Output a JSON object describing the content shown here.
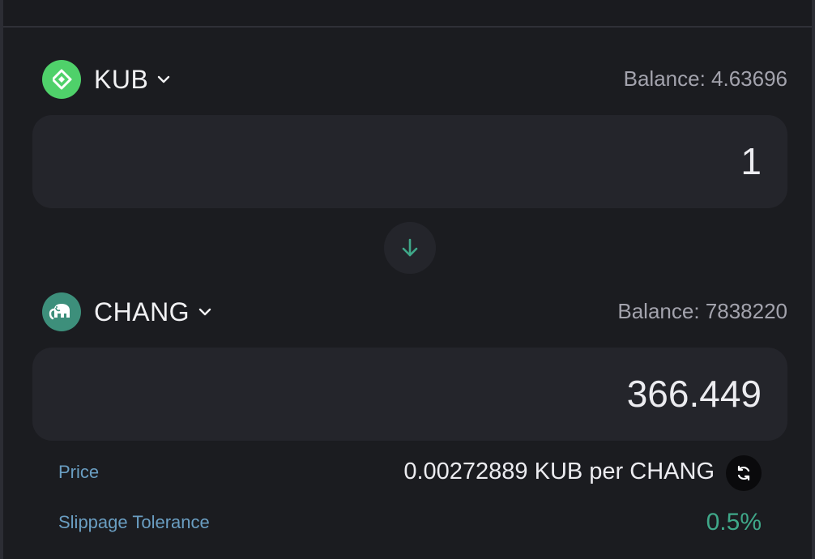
{
  "from": {
    "symbol": "KUB",
    "icon": "kub-logo-icon",
    "balance_text": "Balance: 4.63696",
    "amount": "1",
    "logo_color": "#4fd16a"
  },
  "to": {
    "symbol": "CHANG",
    "icon": "elephant-logo-icon",
    "balance_text": "Balance: 7838220",
    "amount": "366.449",
    "logo_color": "#3d8f7b"
  },
  "swap_direction_icon": "arrow-down-icon",
  "price": {
    "label": "Price",
    "value": "0.00272889 KUB per CHANG",
    "refresh_icon": "refresh-icon"
  },
  "slippage": {
    "label": "Slippage Tolerance",
    "value": "0.5%"
  },
  "colors": {
    "accent_green": "#3fa889",
    "label_blue": "#6a9ec2",
    "background": "#1b1c20",
    "panel": "#24252b"
  }
}
